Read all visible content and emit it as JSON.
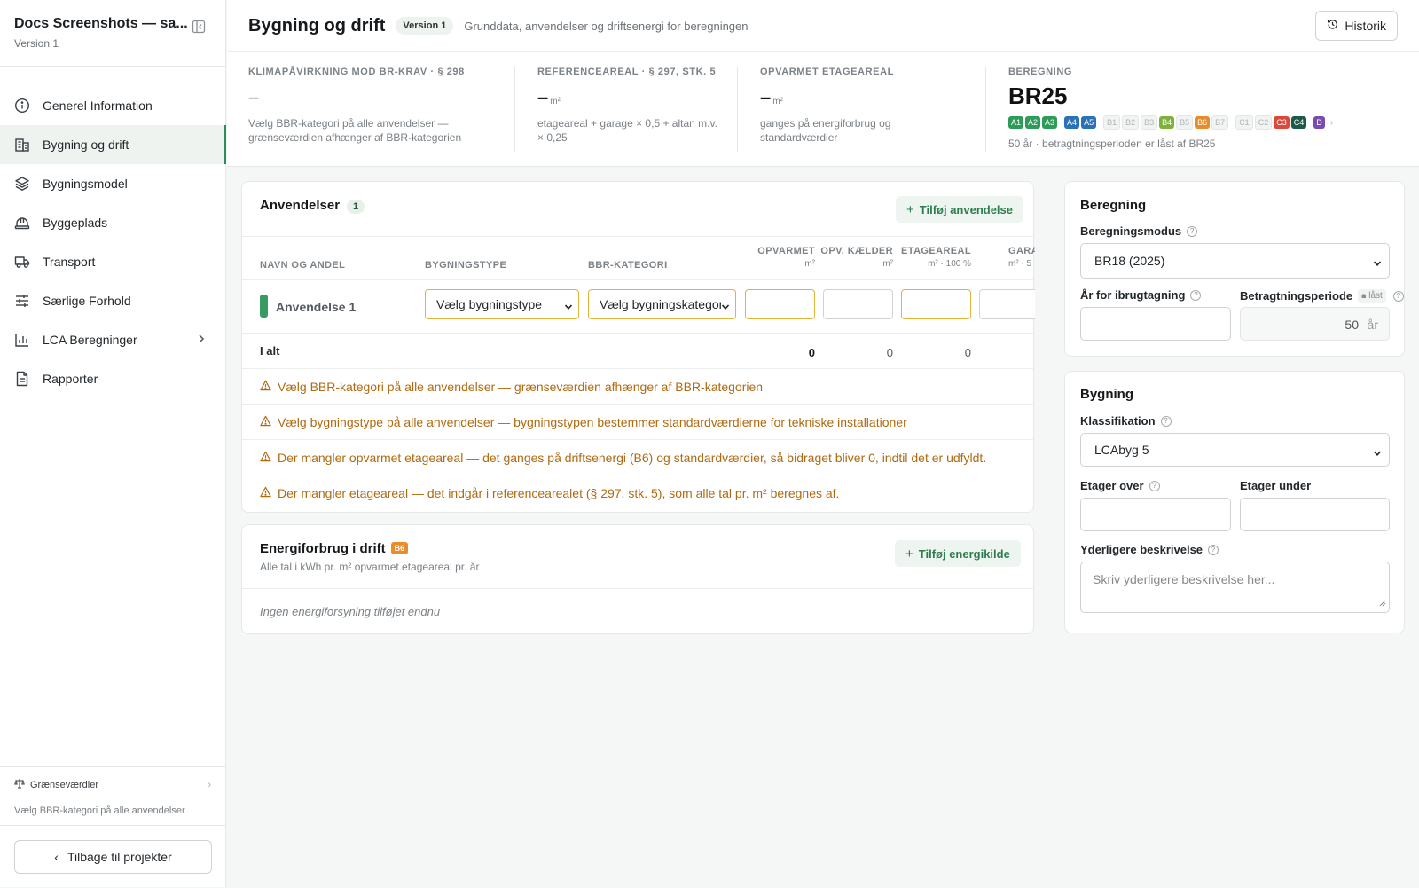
{
  "sidebar": {
    "project_title": "Docs Screenshots — sa...",
    "project_version": "Version 1",
    "items": [
      {
        "label": "Generel Information"
      },
      {
        "label": "Bygning og drift"
      },
      {
        "label": "Bygningsmodel"
      },
      {
        "label": "Byggeplads"
      },
      {
        "label": "Transport"
      },
      {
        "label": "Særlige Forhold"
      },
      {
        "label": "LCA Beregninger"
      },
      {
        "label": "Rapporter"
      }
    ],
    "limits": {
      "label": "Grænseværdier",
      "desc": "Vælg BBR-kategori på alle anvendelser"
    },
    "back_label": "Tilbage til projekter"
  },
  "header": {
    "title": "Bygning og drift",
    "version_badge": "Version 1",
    "description": "Grunddata, anvendelser og driftsenergi for beregningen",
    "history_label": "Historik"
  },
  "stats": {
    "climate": {
      "label": "Klimapåvirkning mod BR-krav · § 298",
      "value": "–",
      "text1": "Vælg BBR-kategori på alle anvendelser —",
      "text2": "grænseværdien afhænger af BBR-kategorien"
    },
    "reference": {
      "label": "Referenceareal · § 297, stk. 5",
      "value": "–",
      "unit": "m²",
      "text1": "etageareal + garage × 0,5 + altan m.v.",
      "text2": "× 0,25"
    },
    "heated": {
      "label": "Opvarmet etageareal",
      "value": "–",
      "unit": "m²",
      "text1": "ganges på energiforbrug og",
      "text2": "standardværdier"
    },
    "calc": {
      "label": "Beregning",
      "value": "BR25",
      "chips": [
        "A1",
        "A2",
        "A3",
        "A4",
        "A5",
        "B1",
        "B2",
        "B3",
        "B4",
        "B5",
        "B6",
        "B7",
        "C1",
        "C2",
        "C3",
        "C4",
        "D"
      ],
      "more": "›",
      "text": "50 år · betragtningsperioden er låst af BR25"
    }
  },
  "uses": {
    "title": "Anvendelser",
    "count": "1",
    "add_label": "Tilføj anvendelse",
    "columns": {
      "name": "Navn og andel",
      "type": "Bygningstype",
      "bbr": "BBR-kategori",
      "heated": "Opvarmet",
      "heated_unit": "m²",
      "basement": "Opv. kælder",
      "basement_unit": "m²",
      "floor": "Etageareal",
      "floor_unit": "m² · 100 %",
      "garage": "Gara",
      "garage_unit": "m² · 5"
    },
    "row": {
      "name": "Anvendelse 1",
      "type_value": "Vælg bygningstype",
      "bbr_value": "Vælg bygningskategori"
    },
    "total": {
      "label": "I alt",
      "heated": "0",
      "basement": "0",
      "floor": "0"
    },
    "warnings": [
      "Vælg BBR-kategori på alle anvendelser — grænseværdien afhænger af BBR-kategorien",
      "Vælg bygningstype på alle anvendelser — bygningstypen bestemmer standardværdierne for tekniske installationer",
      "Der mangler opvarmet etageareal — det ganges på driftsenergi (B6) og standardværdier, så bidraget bliver 0, indtil det er udfyldt.",
      "Der mangler etageareal — det indgår i referencearealet (§ 297, stk. 5), som alle tal pr. m² beregnes af."
    ]
  },
  "energy": {
    "title": "Energiforbrug i drift",
    "badge": "B6",
    "subtitle": "Alle tal i kWh pr. m² opvarmet etageareal pr. år",
    "add_label": "Tilføj energikilde",
    "empty": "Ingen energiforsyning tilføjet endnu"
  },
  "calc_panel": {
    "title": "Beregning",
    "mode_label": "Beregningsmodus",
    "mode_value": "BR18 (2025)",
    "year_label": "År for ibrugtagning",
    "period_label": "Betragtningsperiode",
    "locked": "låst",
    "period_value": "50",
    "period_unit": "år"
  },
  "building_panel": {
    "title": "Bygning",
    "class_label": "Klassifikation",
    "class_value": "LCAbyg 5",
    "above_label": "Etager over",
    "below_label": "Etager under",
    "desc_label": "Yderligere beskrivelse",
    "desc_placeholder": "Skriv yderligere beskrivelse her..."
  },
  "colors": {
    "accent": "#2e8b57",
    "warning": "#b06a10"
  }
}
